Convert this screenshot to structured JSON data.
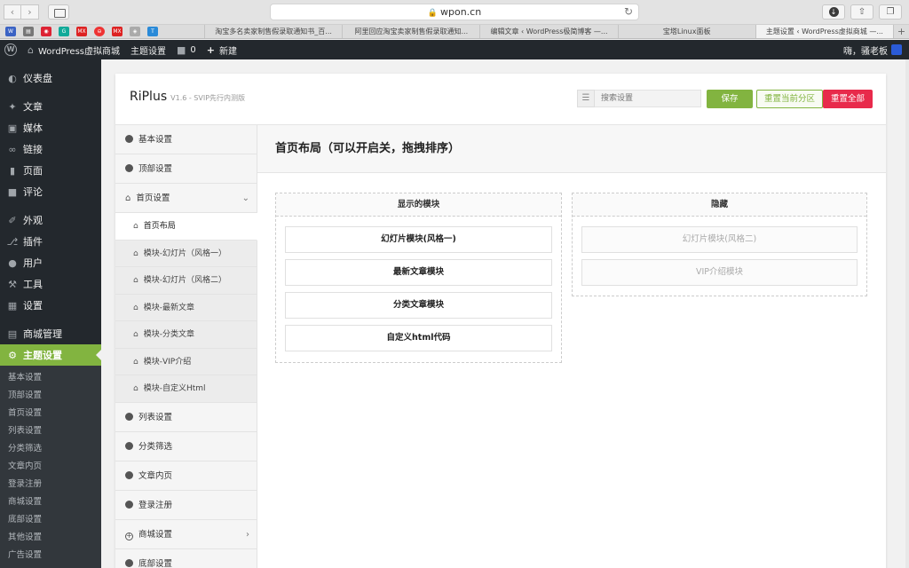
{
  "browser": {
    "url": "wpon.cn",
    "tabs": [
      "淘宝多名卖家制售假录取通知书_百...",
      "阿里回应淘宝卖家制售假录取通知...",
      "编辑文章 ‹ WordPress极简博客 —...",
      "宝塔Linux面板",
      "主题设置 ‹ WordPress虚拟商城 —..."
    ],
    "favicons": [
      "wp",
      "doc",
      "gmail",
      "G",
      "MX",
      "ban",
      "MX",
      "cat",
      "T"
    ]
  },
  "adminbar": {
    "site_name": "WordPress虚拟商城",
    "theme_settings": "主题设置",
    "comments_count": "0",
    "new_label": "新建",
    "greeting": "嗨，骚老板"
  },
  "wp_menu": {
    "items": [
      {
        "label": "仪表盘",
        "icon": "dashboard-icon"
      },
      {
        "label": "文章",
        "icon": "pin-icon"
      },
      {
        "label": "媒体",
        "icon": "media-icon"
      },
      {
        "label": "链接",
        "icon": "link-icon"
      },
      {
        "label": "页面",
        "icon": "page-icon"
      },
      {
        "label": "评论",
        "icon": "comment-icon"
      },
      {
        "label": "外观",
        "icon": "appearance-icon"
      },
      {
        "label": "插件",
        "icon": "plugin-icon"
      },
      {
        "label": "用户",
        "icon": "user-icon"
      },
      {
        "label": "工具",
        "icon": "tools-icon"
      },
      {
        "label": "设置",
        "icon": "settings-icon"
      },
      {
        "label": "商城管理",
        "icon": "cart-icon"
      },
      {
        "label": "主题设置",
        "icon": "gear-icon"
      }
    ],
    "submenu": [
      "基本设置",
      "顶部设置",
      "首页设置",
      "列表设置",
      "分类筛选",
      "文章内页",
      "登录注册",
      "商城设置",
      "底部设置",
      "其他设置",
      "广告设置"
    ]
  },
  "panel": {
    "brand": "RiPlus",
    "version": "V1.6 - SVIP先行内测版",
    "search_placeholder": "搜索设置",
    "save": "保存",
    "reset_section": "重置当前分区",
    "reset_all": "重置全部"
  },
  "options_nav": {
    "basic": "基本设置",
    "top": "顶部设置",
    "home": "首页设置",
    "home_subs": [
      "首页布局",
      "模块-幻灯片（风格一）",
      "模块-幻灯片（风格二）",
      "模块-最新文章",
      "模块-分类文章",
      "模块-VIP介绍",
      "模块-自定义Html"
    ],
    "list": "列表设置",
    "filter": "分类筛选",
    "article": "文章内页",
    "login": "登录注册",
    "shop": "商城设置",
    "footer": "底部设置"
  },
  "main": {
    "section_title": "首页布局（可以开启关，拖拽排序）",
    "enabled_title": "显示的模块",
    "enabled": [
      "幻灯片模块(风格一)",
      "最新文章模块",
      "分类文章模块",
      "自定义html代码"
    ],
    "disabled_title": "隐藏",
    "disabled": [
      "幻灯片模块(风格二)",
      "VIP介绍模块"
    ]
  }
}
